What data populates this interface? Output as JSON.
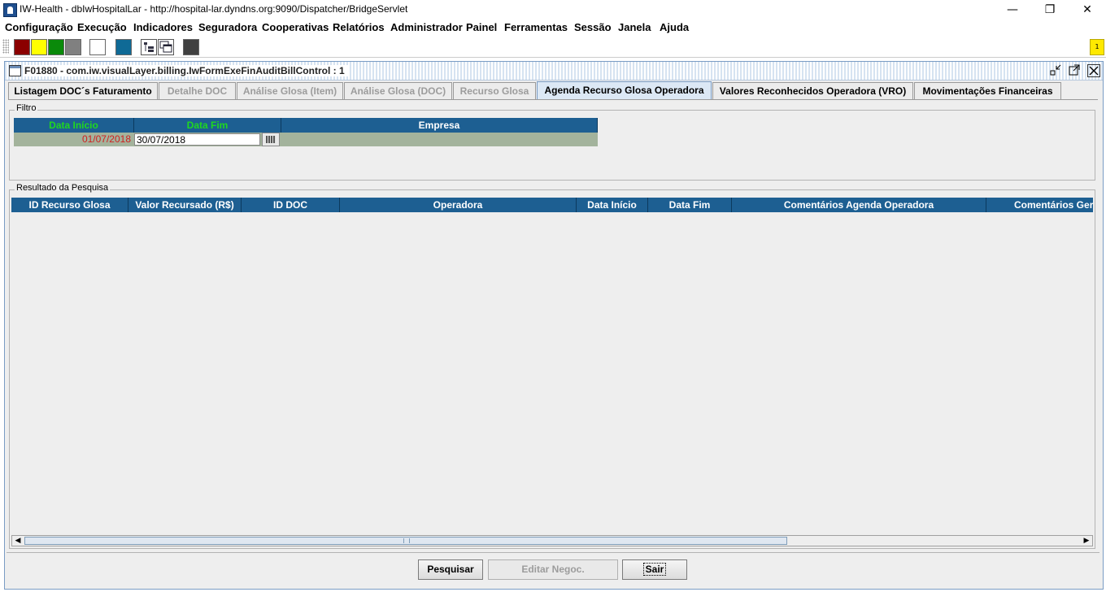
{
  "window": {
    "title": "IW-Health - dbIwHospitalLar - http://hospital-lar.dyndns.org:9090/Dispatcher/BridgeServlet",
    "minimize": "—",
    "maximize": "❐",
    "close": "✕"
  },
  "menu": [
    "Configuração",
    "Execução",
    "Indicadores",
    "Seguradora",
    "Cooperativas",
    "Relatórios",
    "Administrador",
    "Painel",
    "Ferramentas",
    "Sessão",
    "Janela",
    "Ajuda"
  ],
  "toolbar": {
    "colors": [
      "#8b0000",
      "#ffff00",
      "#0a8a0a",
      "#808080",
      "#ffffff",
      "#0f6a96",
      "#404040"
    ],
    "note_label": "1"
  },
  "frame": {
    "title": "F01880 - com.iw.visualLayer.billing.IwFormExeFinAuditBillControl : 1"
  },
  "tabs": [
    {
      "label": "Listagem DOC´s Faturamento",
      "state": "normal"
    },
    {
      "label": "Detalhe DOC",
      "state": "disabled"
    },
    {
      "label": "Análise Glosa (Item)",
      "state": "disabled"
    },
    {
      "label": "Análise Glosa (DOC)",
      "state": "disabled"
    },
    {
      "label": "Recurso Glosa",
      "state": "disabled"
    },
    {
      "label": "Agenda Recurso Glosa Operadora",
      "state": "active"
    },
    {
      "label": "Valores Reconhecidos Operadora (VRO)",
      "state": "normal"
    },
    {
      "label": "Movimentações Financeiras",
      "state": "normal"
    }
  ],
  "filter": {
    "group_label": "Filtro",
    "headers": {
      "data_inicio": "Data Início",
      "data_fim": "Data Fim",
      "empresa": "Empresa"
    },
    "values": {
      "data_inicio": "01/07/2018",
      "data_fim": "30/07/2018",
      "empresa": ""
    }
  },
  "results": {
    "group_label": "Resultado da Pesquisa",
    "columns": [
      "ID Recurso Glosa",
      "Valor Recursado (R$)",
      "ID DOC",
      "Operadora",
      "Data Início",
      "Data Fim",
      "Comentários Agenda Operadora",
      "Comentários Gerais"
    ],
    "rows": []
  },
  "buttons": {
    "search": "Pesquisar",
    "edit": "Editar Negoc.",
    "exit": "Sair"
  }
}
